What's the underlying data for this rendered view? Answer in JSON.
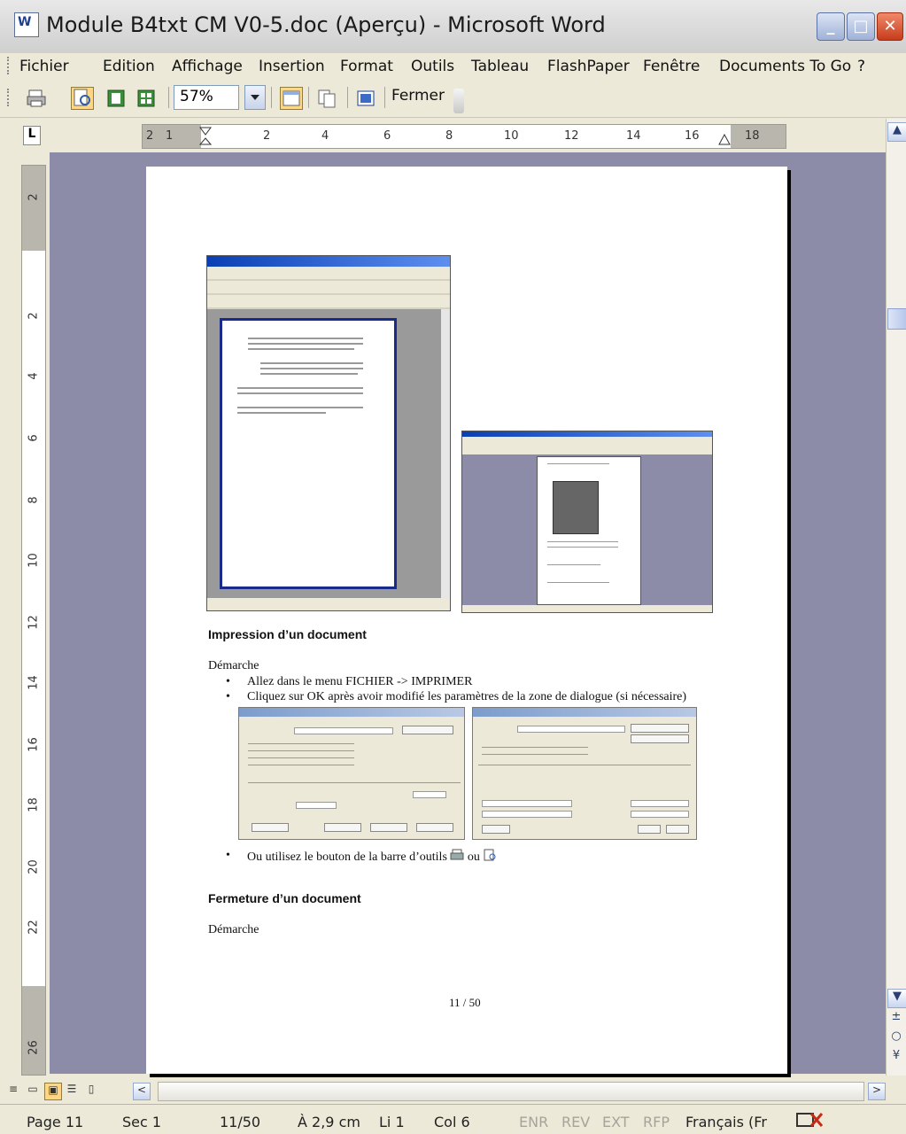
{
  "window": {
    "title": "Module B4txt CM V0-5.doc (Aperçu) - Microsoft Word",
    "icon": "word-doc-icon",
    "controls": [
      "minimize",
      "maximize",
      "close"
    ]
  },
  "menu": {
    "items": [
      "Fichier",
      "Edition",
      "Affichage",
      "Insertion",
      "Format",
      "Outils",
      "Tableau",
      "FlashPaper",
      "Fenêtre",
      "Documents To Go",
      "?"
    ]
  },
  "toolbar": {
    "zoom": "57%",
    "close_label": "Fermer"
  },
  "ruler": {
    "horizontal_labels": [
      "2",
      "1",
      "2",
      "4",
      "6",
      "8",
      "10",
      "12",
      "14",
      "16",
      "18"
    ],
    "vertical_labels": [
      "2",
      "2",
      "4",
      "6",
      "8",
      "10",
      "12",
      "14",
      "16",
      "18",
      "20",
      "22",
      "26"
    ]
  },
  "document": {
    "heading_print": "Impression d’un document",
    "demarche_1": "Démarche",
    "bullet_1": "Allez dans le menu FICHIER -> IMPRIMER",
    "bullet_2": "Cliquez sur OK après avoir modifié les paramètres de la zone de dialogue (si nécessaire)",
    "bullet_3_prefix": "Ou utilisez le bouton de la barre d’outils",
    "bullet_3_or": "ou",
    "heading_close": "Fermeture d’un document",
    "demarche_2": "Démarche",
    "page_number": "11 / 50"
  },
  "status": {
    "page": "Page 11",
    "section": "Sec 1",
    "pages": "11/50",
    "position": "À 2,9 cm",
    "line": "Li 1",
    "col": "Col 6",
    "modes": [
      "ENR",
      "REV",
      "EXT",
      "RFP"
    ],
    "language": "Français (Fr"
  }
}
